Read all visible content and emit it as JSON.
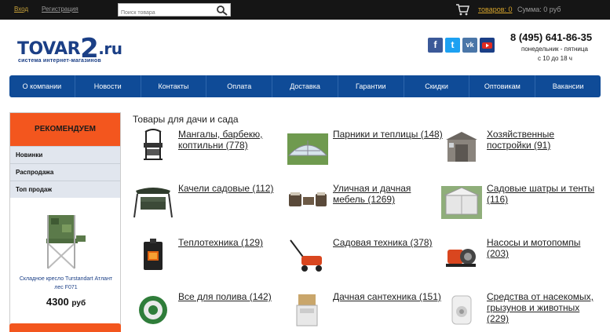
{
  "topbar": {
    "login": "Вход",
    "register": "Регистрация",
    "search_placeholder": "Поиск товара",
    "goods": "товаров: 0",
    "sum": "Сумма: 0 руб"
  },
  "header": {
    "logo_main": "TOVAR",
    "logo_two": "2",
    "logo_ru": ".ru",
    "logo_sub": "система интернет-магазинов",
    "phone": "8 (495) 641-86-35",
    "hours_days": "понедельник - пятница",
    "hours_time": "с 10 до 18 ч"
  },
  "social": {
    "fb": "f",
    "tw": "t",
    "vk": "vk",
    "yt": "You"
  },
  "nav": [
    "О компании",
    "Новости",
    "Контакты",
    "Оплата",
    "Доставка",
    "Гарантии",
    "Скидки",
    "Оптовикам",
    "Вакансии"
  ],
  "sidebar": {
    "recommend": "РЕКОМЕНДУЕМ",
    "items": [
      "Новинки",
      "Распродажа",
      "Топ продаж"
    ],
    "product_name": "Складное кресло Turstandart Атлант лес F071",
    "price": "4300",
    "currency": "руб"
  },
  "main": {
    "title": "Товары для дачи и сада",
    "categories": [
      "Мангалы, барбекю, коптильни (778)",
      "Парники и теплицы (148)",
      "Хозяйственные постройки (91)",
      "Качели садовые (112)",
      "Уличная и дачная мебель (1269)",
      "Садовые шатры и тенты (116)",
      "Теплотехника (129)",
      "Садовая техника (378)",
      "Насосы и мотопомпы (203)",
      "Все для полива (142)",
      "Дачная сантехника (151)",
      "Средства от насекомых, грызунов и животных (229)"
    ]
  },
  "colors": {
    "nav_bg": "#0f4b97",
    "accent_orange": "#f3561e",
    "topbar_bg": "#151515",
    "brand_blue": "#1b3f86"
  }
}
